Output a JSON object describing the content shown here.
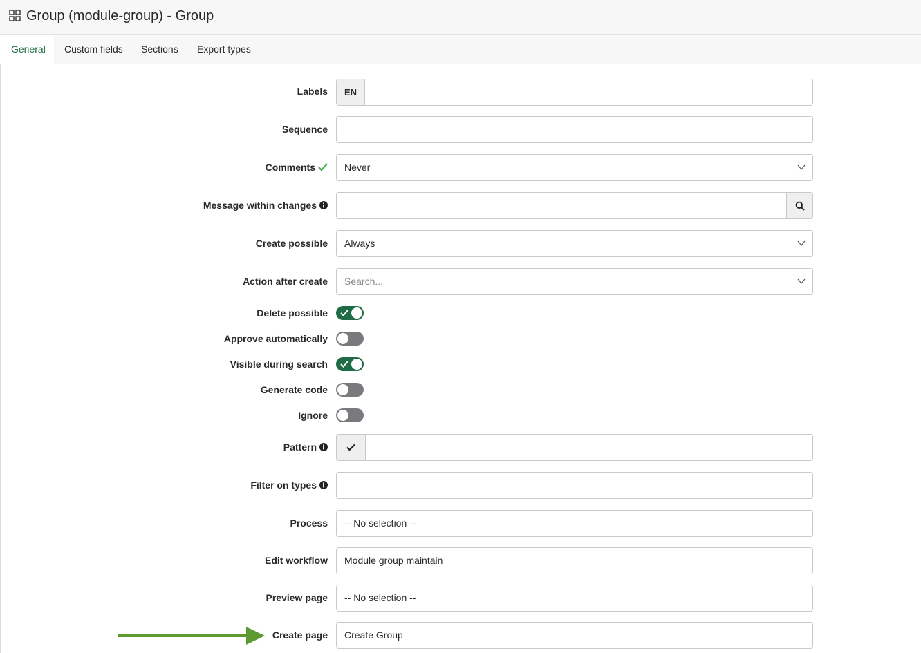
{
  "header": {
    "title": "Group (module-group) - Group",
    "icon": "grid-icon"
  },
  "tabs": [
    {
      "label": "General",
      "active": true
    },
    {
      "label": "Custom fields",
      "active": false
    },
    {
      "label": "Sections",
      "active": false
    },
    {
      "label": "Export types",
      "active": false
    }
  ],
  "form": {
    "labels": {
      "label": "Labels",
      "prefix": "EN",
      "value": ""
    },
    "sequence": {
      "label": "Sequence",
      "value": ""
    },
    "comments": {
      "label": "Comments",
      "value": "Never",
      "status_icon": "check-icon"
    },
    "message_within_changes": {
      "label": "Message within changes",
      "value": "",
      "info_icon": "info-icon",
      "button_icon": "search-icon"
    },
    "create_possible": {
      "label": "Create possible",
      "value": "Always"
    },
    "action_after_create": {
      "label": "Action after create",
      "placeholder": "Search..."
    },
    "delete_possible": {
      "label": "Delete possible",
      "on": true
    },
    "approve_automatically": {
      "label": "Approve automatically",
      "on": false
    },
    "visible_during_search": {
      "label": "Visible during search",
      "on": true
    },
    "generate_code": {
      "label": "Generate code",
      "on": false
    },
    "ignore": {
      "label": "Ignore",
      "on": false
    },
    "pattern": {
      "label": "Pattern",
      "value": "",
      "info_icon": "info-icon",
      "prefix_icon": "check-icon"
    },
    "filter_on_types": {
      "label": "Filter on types",
      "value": "",
      "info_icon": "info-icon"
    },
    "process": {
      "label": "Process",
      "value": "-- No selection --"
    },
    "edit_workflow": {
      "label": "Edit workflow",
      "value": "Module group maintain"
    },
    "preview_page": {
      "label": "Preview page",
      "value": "-- No selection --"
    },
    "create_page": {
      "label": "Create page",
      "value": "Create Group"
    }
  },
  "colors": {
    "accent": "#1f6b45",
    "toggle_off": "#7a7a7e",
    "check_green": "#4caf50",
    "arrow": "#5e9a32"
  }
}
